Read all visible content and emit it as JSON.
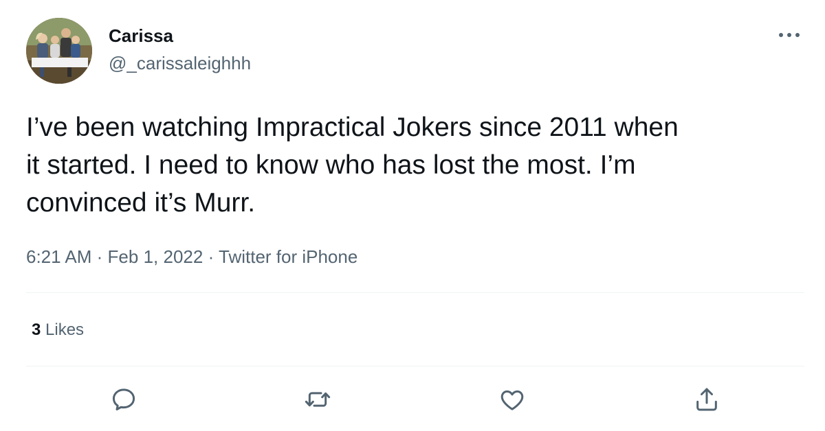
{
  "tweet": {
    "author": {
      "display_name": "Carissa",
      "handle": "@_carissaleighhh",
      "avatar_icon": "family-photo-avatar"
    },
    "more_icon": "more-dots-icon",
    "text": "I’ve been watching Impractical Jokers since 2011 when\nit started. I need to know who has lost the most. I’m\nconvinced it’s Murr.",
    "time": "6:21 AM",
    "separator": "·",
    "date": "Feb 1, 2022",
    "source": "Twitter for iPhone",
    "likes": {
      "count": "3",
      "label": "Likes"
    },
    "actions": [
      {
        "name": "reply",
        "icon": "reply-icon"
      },
      {
        "name": "retweet",
        "icon": "retweet-icon"
      },
      {
        "name": "like",
        "icon": "heart-icon"
      },
      {
        "name": "share",
        "icon": "share-icon"
      }
    ],
    "colors": {
      "text_primary": "#0f1419",
      "text_secondary": "#536471",
      "divider": "#eff3f4",
      "background": "#ffffff"
    }
  }
}
